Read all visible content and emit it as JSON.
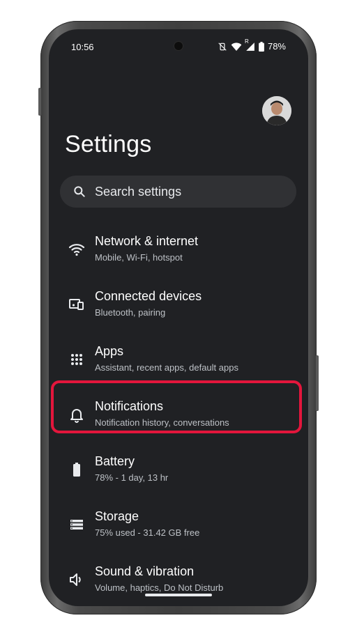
{
  "status_bar": {
    "time": "10:56",
    "signal_badge": "R",
    "battery": "78%",
    "icons": [
      "vibrate-off-icon",
      "wifi-icon",
      "signal-icon",
      "battery-icon"
    ]
  },
  "header": {
    "title": "Settings"
  },
  "search": {
    "placeholder": "Search settings",
    "icon": "search-icon"
  },
  "items": [
    {
      "label": "Network & internet",
      "sub": "Mobile, Wi-Fi, hotspot",
      "icon": "wifi-icon"
    },
    {
      "label": "Connected devices",
      "sub": "Bluetooth, pairing",
      "icon": "devices-icon"
    },
    {
      "label": "Apps",
      "sub": "Assistant, recent apps, default apps",
      "icon": "apps-grid-icon"
    },
    {
      "label": "Notifications",
      "sub": "Notification history, conversations",
      "icon": "bell-icon"
    },
    {
      "label": "Battery",
      "sub": "78% - 1 day, 13 hr",
      "icon": "battery-icon"
    },
    {
      "label": "Storage",
      "sub": "75% used - 31.42 GB free",
      "icon": "storage-icon"
    },
    {
      "label": "Sound & vibration",
      "sub": "Volume, haptics, Do Not Disturb",
      "icon": "speaker-icon"
    }
  ],
  "colors": {
    "background": "#202124",
    "search_bg": "#303134",
    "highlight": "#e3163c",
    "text_primary": "#ffffff",
    "text_secondary": "#bdc1c6"
  }
}
